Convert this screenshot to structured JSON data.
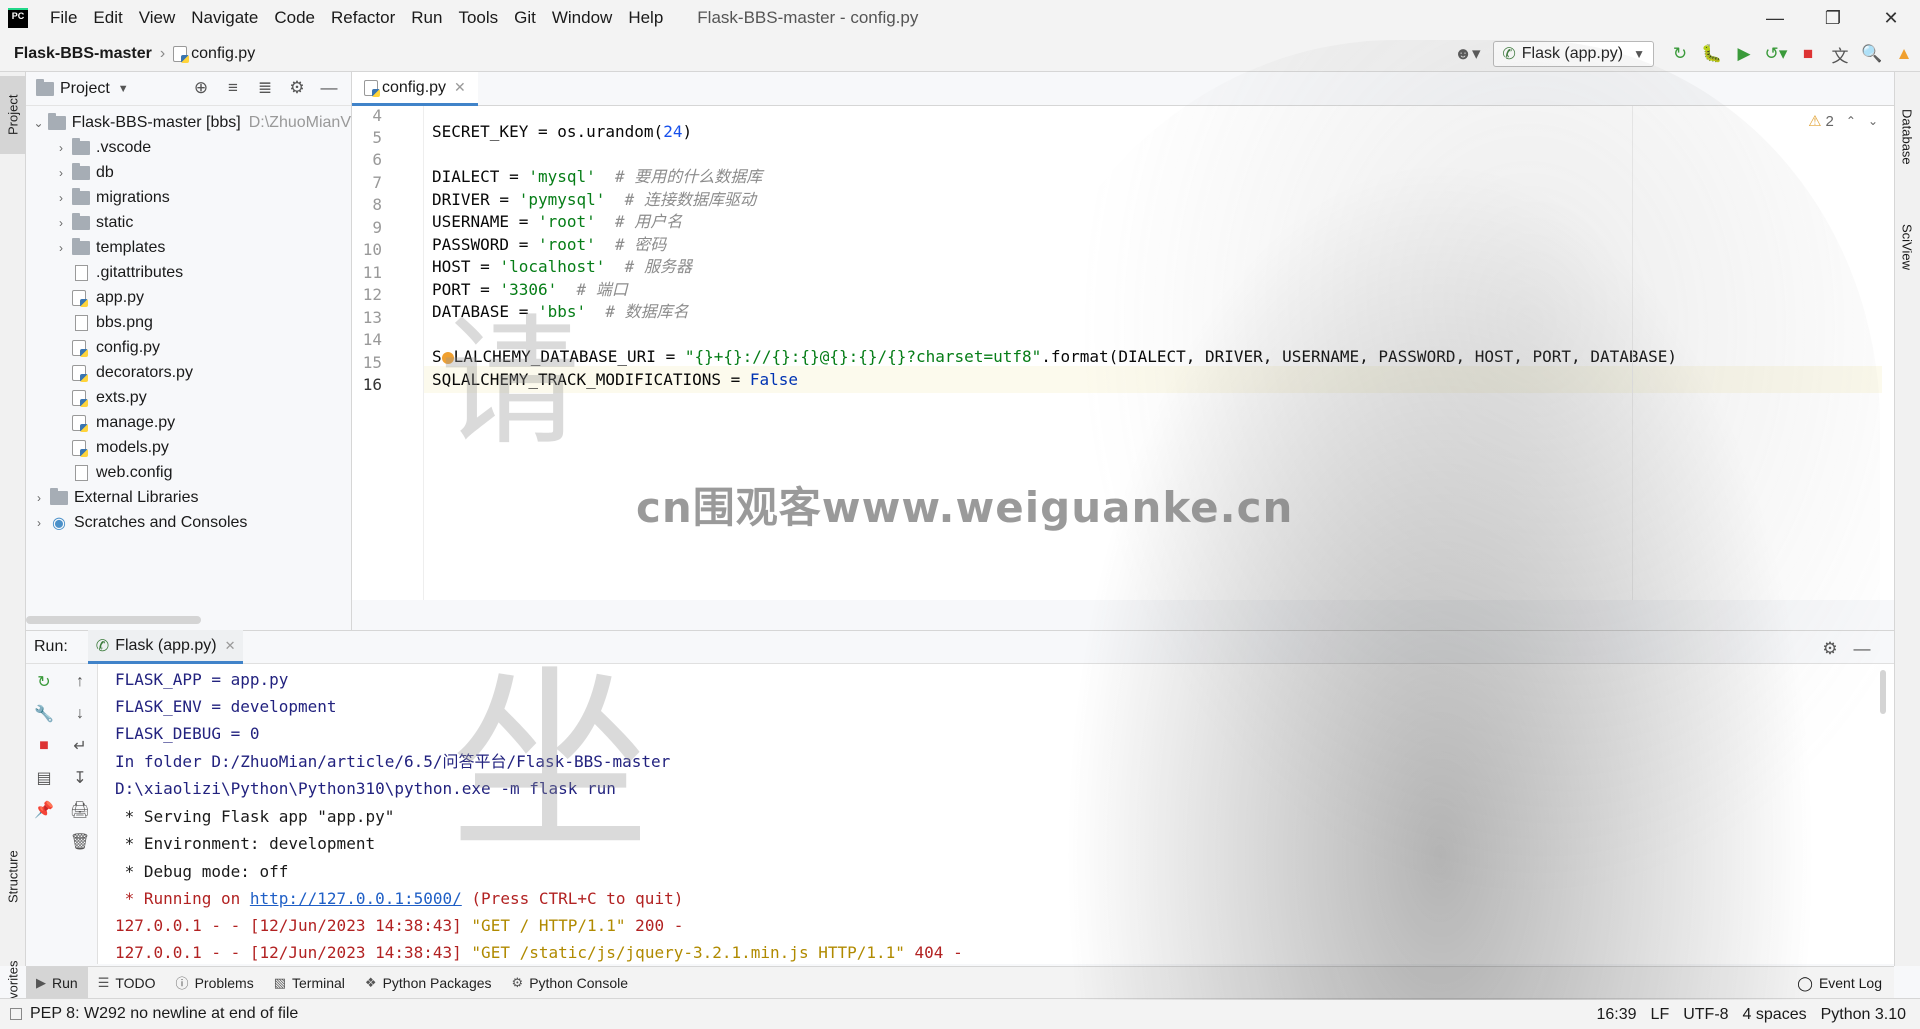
{
  "menubar": {
    "items": [
      "File",
      "Edit",
      "View",
      "Navigate",
      "Code",
      "Refactor",
      "Run",
      "Tools",
      "Git",
      "Window",
      "Help"
    ],
    "window_title": "Flask-BBS-master - config.py"
  },
  "navbar": {
    "project": "Flask-BBS-master",
    "file": "config.py",
    "run_config": "Flask (app.py)"
  },
  "project_panel": {
    "title": "Project",
    "root": {
      "label": "Flask-BBS-master [bbs]",
      "path": "D:\\ZhuoMianV"
    },
    "folders": [
      "vscode",
      "db",
      "migrations",
      "static",
      "templates"
    ],
    "folder_first": ".vscode",
    "files": [
      ".gitattributes",
      "app.py",
      "bbs.png",
      "config.py",
      "decorators.py",
      "exts.py",
      "manage.py",
      "models.py",
      "web.config"
    ],
    "extra": [
      "External Libraries",
      "Scratches and Consoles"
    ]
  },
  "editor": {
    "tab": "config.py",
    "inspection_count": "2",
    "line_numbers": [
      "4",
      "5",
      "6",
      "7",
      "8",
      "9",
      "10",
      "11",
      "12",
      "13",
      "14",
      "15",
      "16"
    ],
    "code": {
      "l5": {
        "a": "SECRET_KEY = os.urandom(",
        "n": "24",
        "b": ")"
      },
      "l7": {
        "a": "DIALECT = ",
        "s": "'mysql'",
        "c": "  # 要用的什么数据库"
      },
      "l8": {
        "a": "DRIVER = ",
        "s": "'pymysql'",
        "c": "  # 连接数据库驱动"
      },
      "l9": {
        "a": "USERNAME = ",
        "s": "'root'",
        "c": "  # 用户名"
      },
      "l10": {
        "a": "PASSWORD = ",
        "s": "'root'",
        "c": "  # 密码"
      },
      "l11": {
        "a": "HOST = ",
        "s": "'localhost'",
        "c": "  # 服务器"
      },
      "l12": {
        "a": "PORT = ",
        "s": "'3306'",
        "c": "  # 端口"
      },
      "l13": {
        "a": "DATABASE = ",
        "s": "'bbs'",
        "c": "  # 数据库名"
      },
      "l15": {
        "a1": "S",
        "a2": "LALCHEMY_DATABASE_URI = ",
        "s": "\"{}+{}://{}:{}@{}:{}/{}?charset=utf8\"",
        "b": ".format(DIALECT, DRIVER, USERNAME, PASSWORD, HOST, PORT, DATABASE)"
      },
      "l16": {
        "a": "SQLALCHEMY_TRACK_MODIFICATIONS = ",
        "k": "False"
      }
    }
  },
  "run_panel": {
    "label": "Run:",
    "tab": "Flask (app.py)",
    "console": {
      "l1": "FLASK_APP = app.py",
      "l2": "FLASK_ENV = development",
      "l3": "FLASK_DEBUG = 0",
      "l4": "In folder D:/ZhuoMian/article/6.5/问答平台/Flask-BBS-master",
      "l5": "D:\\xiaolizi\\Python\\Python310\\python.exe -m flask run",
      "l6": " * Serving Flask app \"app.py\"",
      "l7": " * Environment: development",
      "l8": " * Debug mode: off",
      "l9a": " * Running on ",
      "l9link": "http://127.0.0.1:5000/",
      "l9b": " (Press CTRL+C to quit)",
      "l10a": "127.0.0.1 - - [12/Jun/2023 14:38:43] ",
      "l10b": "\"GET / HTTP/1.1\"",
      "l10c": " 200 -",
      "l11a": "127.0.0.1 - - [12/Jun/2023 14:38:43] ",
      "l11b": "\"GET /static/js/jquery-3.2.1.min.js HTTP/1.1\"",
      "l11c": " 404 -"
    }
  },
  "tool_tabs": [
    "Run",
    "TODO",
    "Problems",
    "Terminal",
    "Python Packages",
    "Python Console"
  ],
  "event_log": "Event Log",
  "stripes": {
    "project": "Project",
    "structure": "Structure",
    "favorites": "Favorites",
    "database": "Database",
    "sciview": "SciView"
  },
  "statusbar": {
    "message": "PEP 8: W292 no newline at end of file",
    "position": "16:39",
    "line_sep": "LF",
    "encoding": "UTF-8",
    "indent": "4 spaces",
    "interpreter": "Python 3.10"
  },
  "watermark": {
    "text": "cn围观客www.weiguanke.cn",
    "char1": "请",
    "char2": "坐"
  },
  "colors": {
    "accent": "#4083c9",
    "string": "#067d17",
    "number": "#1750eb",
    "comment": "#8c8c8c",
    "keyword": "#0033b3",
    "console_error": "#b22222"
  }
}
